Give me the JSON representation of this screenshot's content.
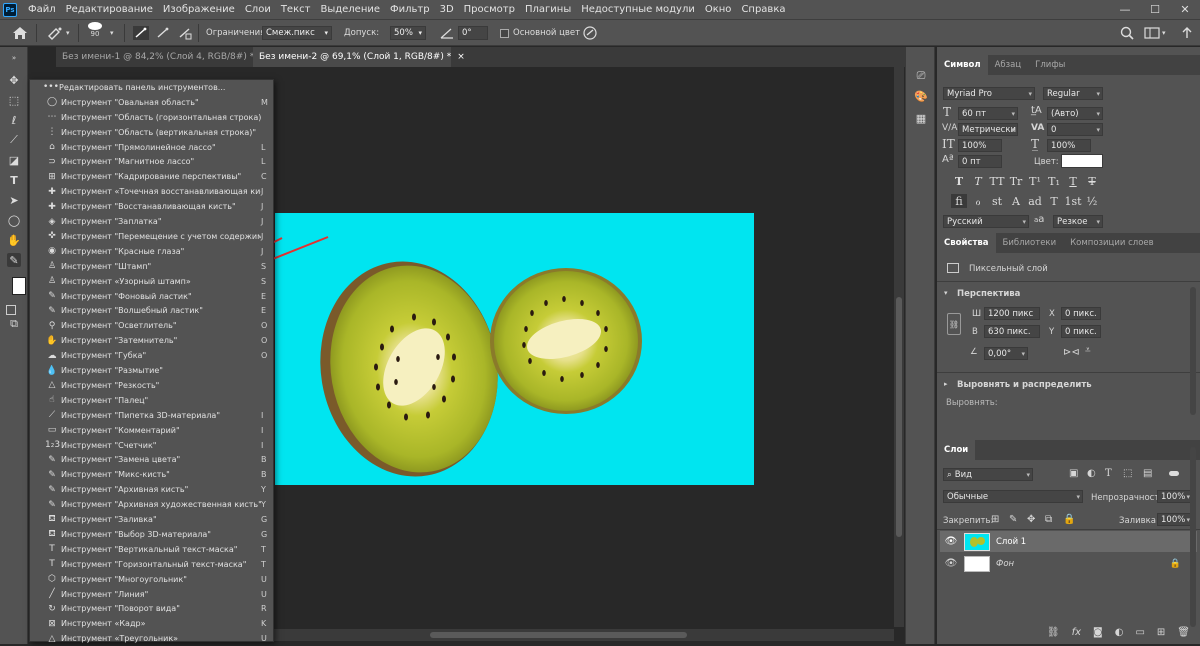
{
  "app": {
    "logo": "Ps"
  },
  "menu": [
    "Файл",
    "Редактирование",
    "Изображение",
    "Слои",
    "Текст",
    "Выделение",
    "Фильтр",
    "3D",
    "Просмотр",
    "Плагины",
    "Недоступные модули",
    "Окно",
    "Справка"
  ],
  "window_controls": {
    "minimize": "—",
    "maximize": "☐",
    "close": "✕"
  },
  "options": {
    "brush_size": "90",
    "limits_label": "Ограничения:",
    "limits_value": "Смеж.пикс",
    "tolerance_label": "Допуск:",
    "tolerance_value": "50%",
    "angle_value": "0°",
    "protect_fg_label": "Основной цвет"
  },
  "tabs": [
    {
      "label": "Без имени-1 @ 84,2% (Слой 4, RGB/8#) *",
      "close": "×"
    },
    {
      "label": "Без имени-2 @ 69,1% (Слой 1, RGB/8#) *",
      "close": "×"
    }
  ],
  "flyout": {
    "header": "Редактировать панель инструментов...",
    "items": [
      {
        "label": "Инструмент \"Овальная область\"",
        "key": "M",
        "icon": "ellipse-marquee-icon",
        "glyph": "◯"
      },
      {
        "label": "Инструмент \"Область (горизонтальная строка)\"",
        "key": "",
        "icon": "single-row-marquee-icon",
        "glyph": "⋯"
      },
      {
        "label": "Инструмент \"Область (вертикальная строка)\"",
        "key": "",
        "icon": "single-column-marquee-icon",
        "glyph": "⋮"
      },
      {
        "label": "Инструмент \"Прямолинейное лассо\"",
        "key": "L",
        "icon": "polygonal-lasso-icon",
        "glyph": "⌂"
      },
      {
        "label": "Инструмент \"Магнитное лассо\"",
        "key": "L",
        "icon": "magnetic-lasso-icon",
        "glyph": "⊃"
      },
      {
        "label": "Инструмент \"Кадрирование перспективы\"",
        "key": "C",
        "icon": "perspective-crop-icon",
        "glyph": "⊞"
      },
      {
        "label": "Инструмент «Точечная восстанавливающая кисть»",
        "key": "J",
        "icon": "spot-healing-icon",
        "glyph": "✚"
      },
      {
        "label": "Инструмент \"Восстанавливающая кисть\"",
        "key": "J",
        "icon": "healing-brush-icon",
        "glyph": "✚"
      },
      {
        "label": "Инструмент \"Заплатка\"",
        "key": "J",
        "icon": "patch-icon",
        "glyph": "◈"
      },
      {
        "label": "Инструмент \"Перемещение с учетом содержимого\"",
        "key": "J",
        "icon": "content-aware-move-icon",
        "glyph": "✜"
      },
      {
        "label": "Инструмент \"Красные глаза\"",
        "key": "J",
        "icon": "red-eye-icon",
        "glyph": "◉"
      },
      {
        "label": "Инструмент \"Штамп\"",
        "key": "S",
        "icon": "clone-stamp-icon",
        "glyph": "♙"
      },
      {
        "label": "Инструмент «Узорный штамп»",
        "key": "S",
        "icon": "pattern-stamp-icon",
        "glyph": "♙"
      },
      {
        "label": "Инструмент \"Фоновый ластик\"",
        "key": "E",
        "icon": "background-eraser-icon",
        "glyph": "✎"
      },
      {
        "label": "Инструмент \"Волшебный ластик\"",
        "key": "E",
        "icon": "magic-eraser-icon",
        "glyph": "✎"
      },
      {
        "label": "Инструмент \"Осветлитель\"",
        "key": "O",
        "icon": "dodge-icon",
        "glyph": "⚲"
      },
      {
        "label": "Инструмент \"Затемнитель\"",
        "key": "O",
        "icon": "burn-icon",
        "glyph": "✋"
      },
      {
        "label": "Инструмент \"Губка\"",
        "key": "O",
        "icon": "sponge-icon",
        "glyph": "☁"
      },
      {
        "label": "Инструмент \"Размытие\"",
        "key": "",
        "icon": "blur-icon",
        "glyph": "💧"
      },
      {
        "label": "Инструмент \"Резкость\"",
        "key": "",
        "icon": "sharpen-icon",
        "glyph": "△"
      },
      {
        "label": "Инструмент \"Палец\"",
        "key": "",
        "icon": "smudge-icon",
        "glyph": "☝"
      },
      {
        "label": "Инструмент \"Пипетка 3D-материала\"",
        "key": "I",
        "icon": "3d-material-eyedropper-icon",
        "glyph": "⟋"
      },
      {
        "label": "Инструмент \"Комментарий\"",
        "key": "I",
        "icon": "note-icon",
        "glyph": "▭"
      },
      {
        "label": "Инструмент \"Счетчик\"",
        "key": "I",
        "icon": "count-icon",
        "glyph": "1₂3"
      },
      {
        "label": "Инструмент \"Замена цвета\"",
        "key": "B",
        "icon": "color-replacement-icon",
        "glyph": "✎"
      },
      {
        "label": "Инструмент \"Микс-кисть\"",
        "key": "B",
        "icon": "mixer-brush-icon",
        "glyph": "✎"
      },
      {
        "label": "Инструмент \"Архивная кисть\"",
        "key": "Y",
        "icon": "history-brush-icon",
        "glyph": "✎"
      },
      {
        "label": "Инструмент \"Архивная художественная кисть\"",
        "key": "Y",
        "icon": "art-history-brush-icon",
        "glyph": "✎"
      },
      {
        "label": "Инструмент \"Заливка\"",
        "key": "G",
        "icon": "paint-bucket-icon",
        "glyph": "⛾"
      },
      {
        "label": "Инструмент \"Выбор 3D-материала\"",
        "key": "G",
        "icon": "3d-material-drop-icon",
        "glyph": "⛾"
      },
      {
        "label": "Инструмент \"Вертикальный текст-маска\"",
        "key": "T",
        "icon": "vertical-type-mask-icon",
        "glyph": "T"
      },
      {
        "label": "Инструмент \"Горизонтальный текст-маска\"",
        "key": "T",
        "icon": "horizontal-type-mask-icon",
        "glyph": "T"
      },
      {
        "label": "Инструмент \"Многоугольник\"",
        "key": "U",
        "icon": "polygon-icon",
        "glyph": "⬡"
      },
      {
        "label": "Инструмент \"Линия\"",
        "key": "U",
        "icon": "line-icon",
        "glyph": "╱"
      },
      {
        "label": "Инструмент \"Поворот вида\"",
        "key": "R",
        "icon": "rotate-view-icon",
        "glyph": "↻"
      },
      {
        "label": "Инструмент «Кадр»",
        "key": "K",
        "icon": "frame-icon",
        "glyph": "⊠"
      },
      {
        "label": "Инструмент «Треугольник»",
        "key": "U",
        "icon": "triangle-icon",
        "glyph": "△"
      }
    ]
  },
  "character": {
    "tabs": [
      "Символ",
      "Абзац",
      "Глифы"
    ],
    "font_family": "Myriad Pro",
    "font_style": "Regular",
    "size": "60 пт",
    "leading": "(Авто)",
    "kerning": "Метрически",
    "tracking": "0",
    "vscale": "100%",
    "hscale": "100%",
    "baseline": "0 пт",
    "color_label": "Цвет:",
    "type_buttons": [
      "T",
      "T",
      "TT",
      "Tr",
      "T¹",
      "T₁",
      "T",
      "T̶"
    ],
    "ot_buttons": [
      "fi",
      "ℴ",
      "st",
      "A",
      "ad",
      "T",
      "1st",
      "½"
    ],
    "language": "Русский",
    "aa_label": "a",
    "antialias": "Резкое"
  },
  "properties": {
    "tabs": [
      "Свойства",
      "Библиотеки",
      "Композиции слоев"
    ],
    "layer_type": "Пиксельный слой",
    "perspective": "Перспектива",
    "w_label": "Ш",
    "w": "1200 пикс",
    "h_label": "В",
    "h": "630 пикс.",
    "x_label": "X",
    "x": "0 пикс.",
    "y_label": "Y",
    "y": "0 пикс.",
    "angle": "0,00°",
    "align_header": "Выровнять и распределить",
    "align_label": "Выровнять:"
  },
  "layers": {
    "tabs": [
      "Слои"
    ],
    "filter": "Вид",
    "blend_mode": "Обычные",
    "opacity_label": "Непрозрачность:",
    "opacity": "100%",
    "lock_label": "Закрепить:",
    "fill_label": "Заливка:",
    "fill": "100%",
    "items": [
      {
        "name": "Слой 1",
        "selected": true
      },
      {
        "name": "Фон",
        "selected": false
      }
    ],
    "footer_icons": [
      "link-icon",
      "fx-icon",
      "mask-icon",
      "adjustment-icon",
      "folder-icon",
      "new-layer-icon",
      "trash-icon"
    ]
  },
  "colors": {
    "canvas_bg": "#00e5f0",
    "arrow": "#e53030",
    "kiwi_flesh": "#b4c12a",
    "kiwi_core": "#f6f0c0"
  }
}
